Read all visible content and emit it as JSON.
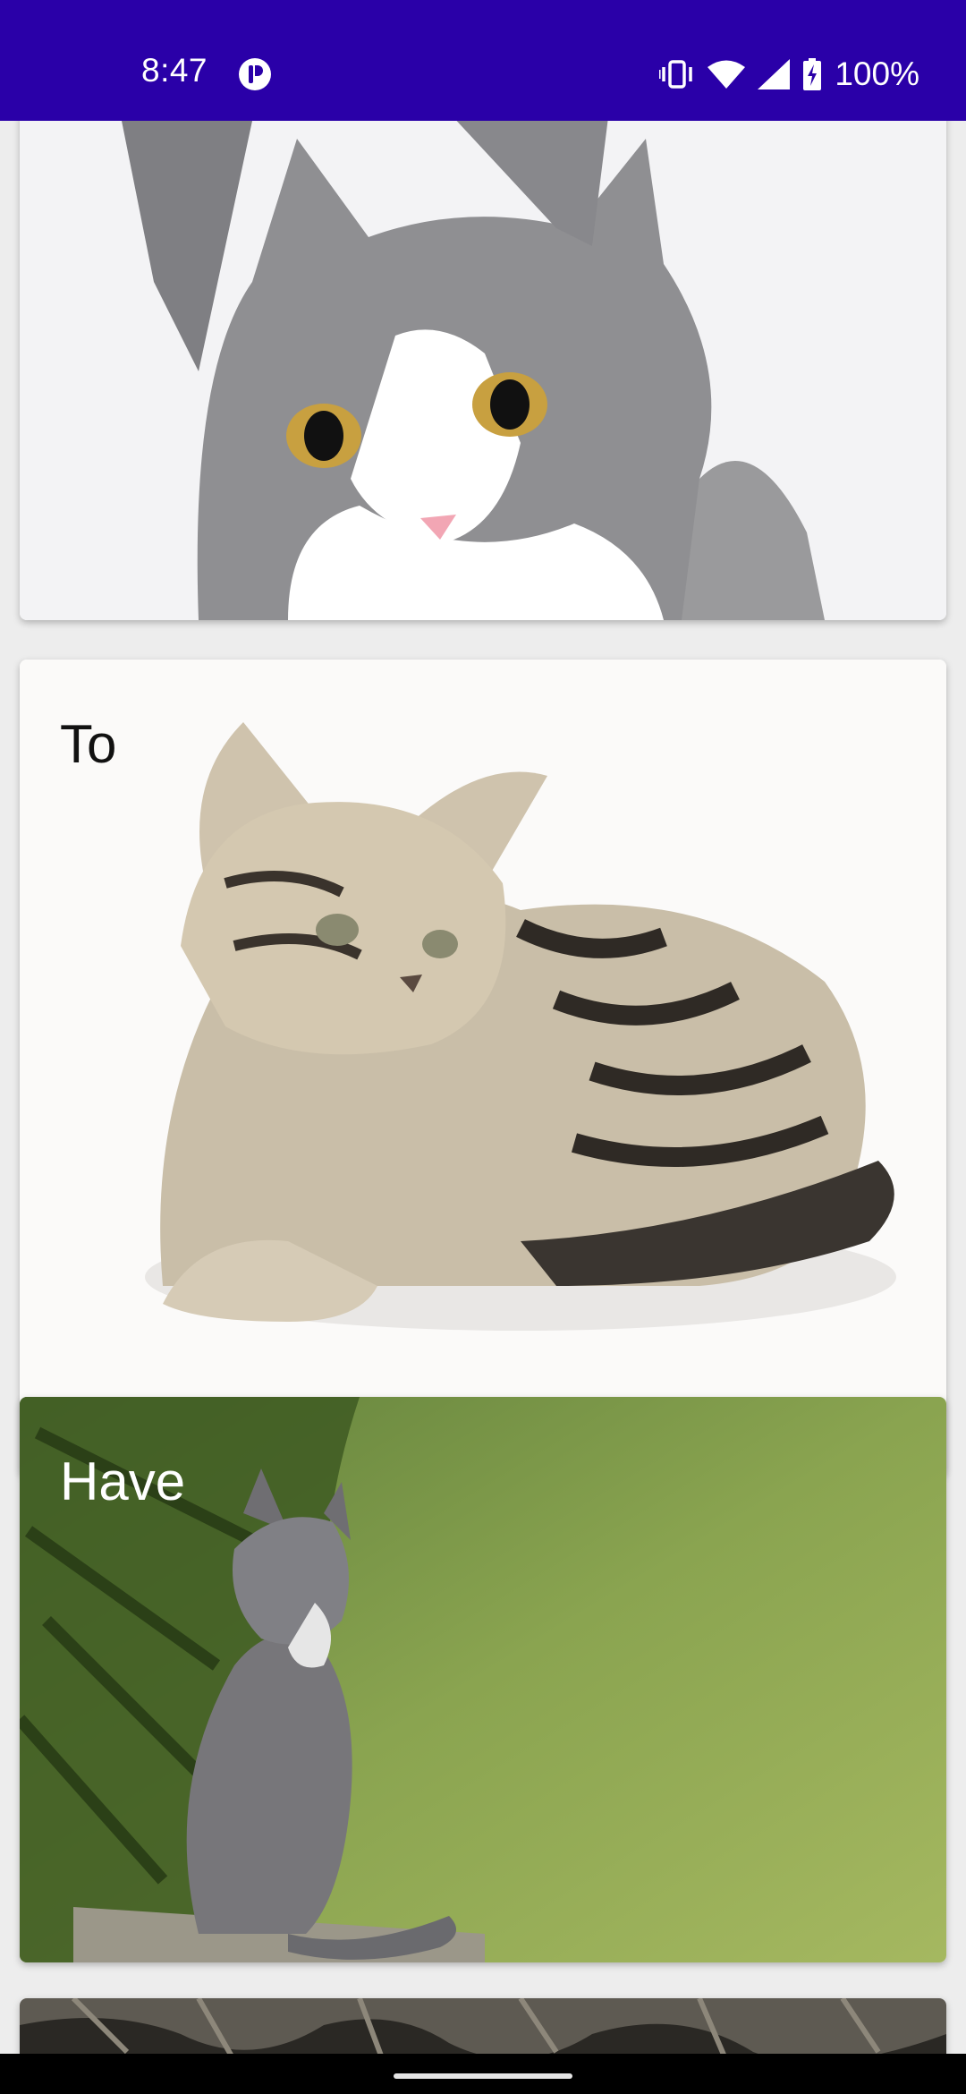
{
  "status_bar": {
    "time": "8:47",
    "battery": "100%",
    "background": "#2a00a8",
    "icons": [
      "app-badge-icon",
      "vibrate-icon",
      "wifi-icon",
      "cell-signal-icon",
      "battery-charging-icon"
    ]
  },
  "feed": {
    "cards": [
      {
        "label": "",
        "image": "gray-white-cat-photo"
      },
      {
        "label": "To",
        "image": "tabby-kitten-lying-photo",
        "label_color": "#111111"
      },
      {
        "label": "Have",
        "image": "kitten-by-pine-tree-photo",
        "label_color": "#ffffff"
      },
      {
        "label": "",
        "image": "cat-closeup-photo"
      }
    ]
  }
}
